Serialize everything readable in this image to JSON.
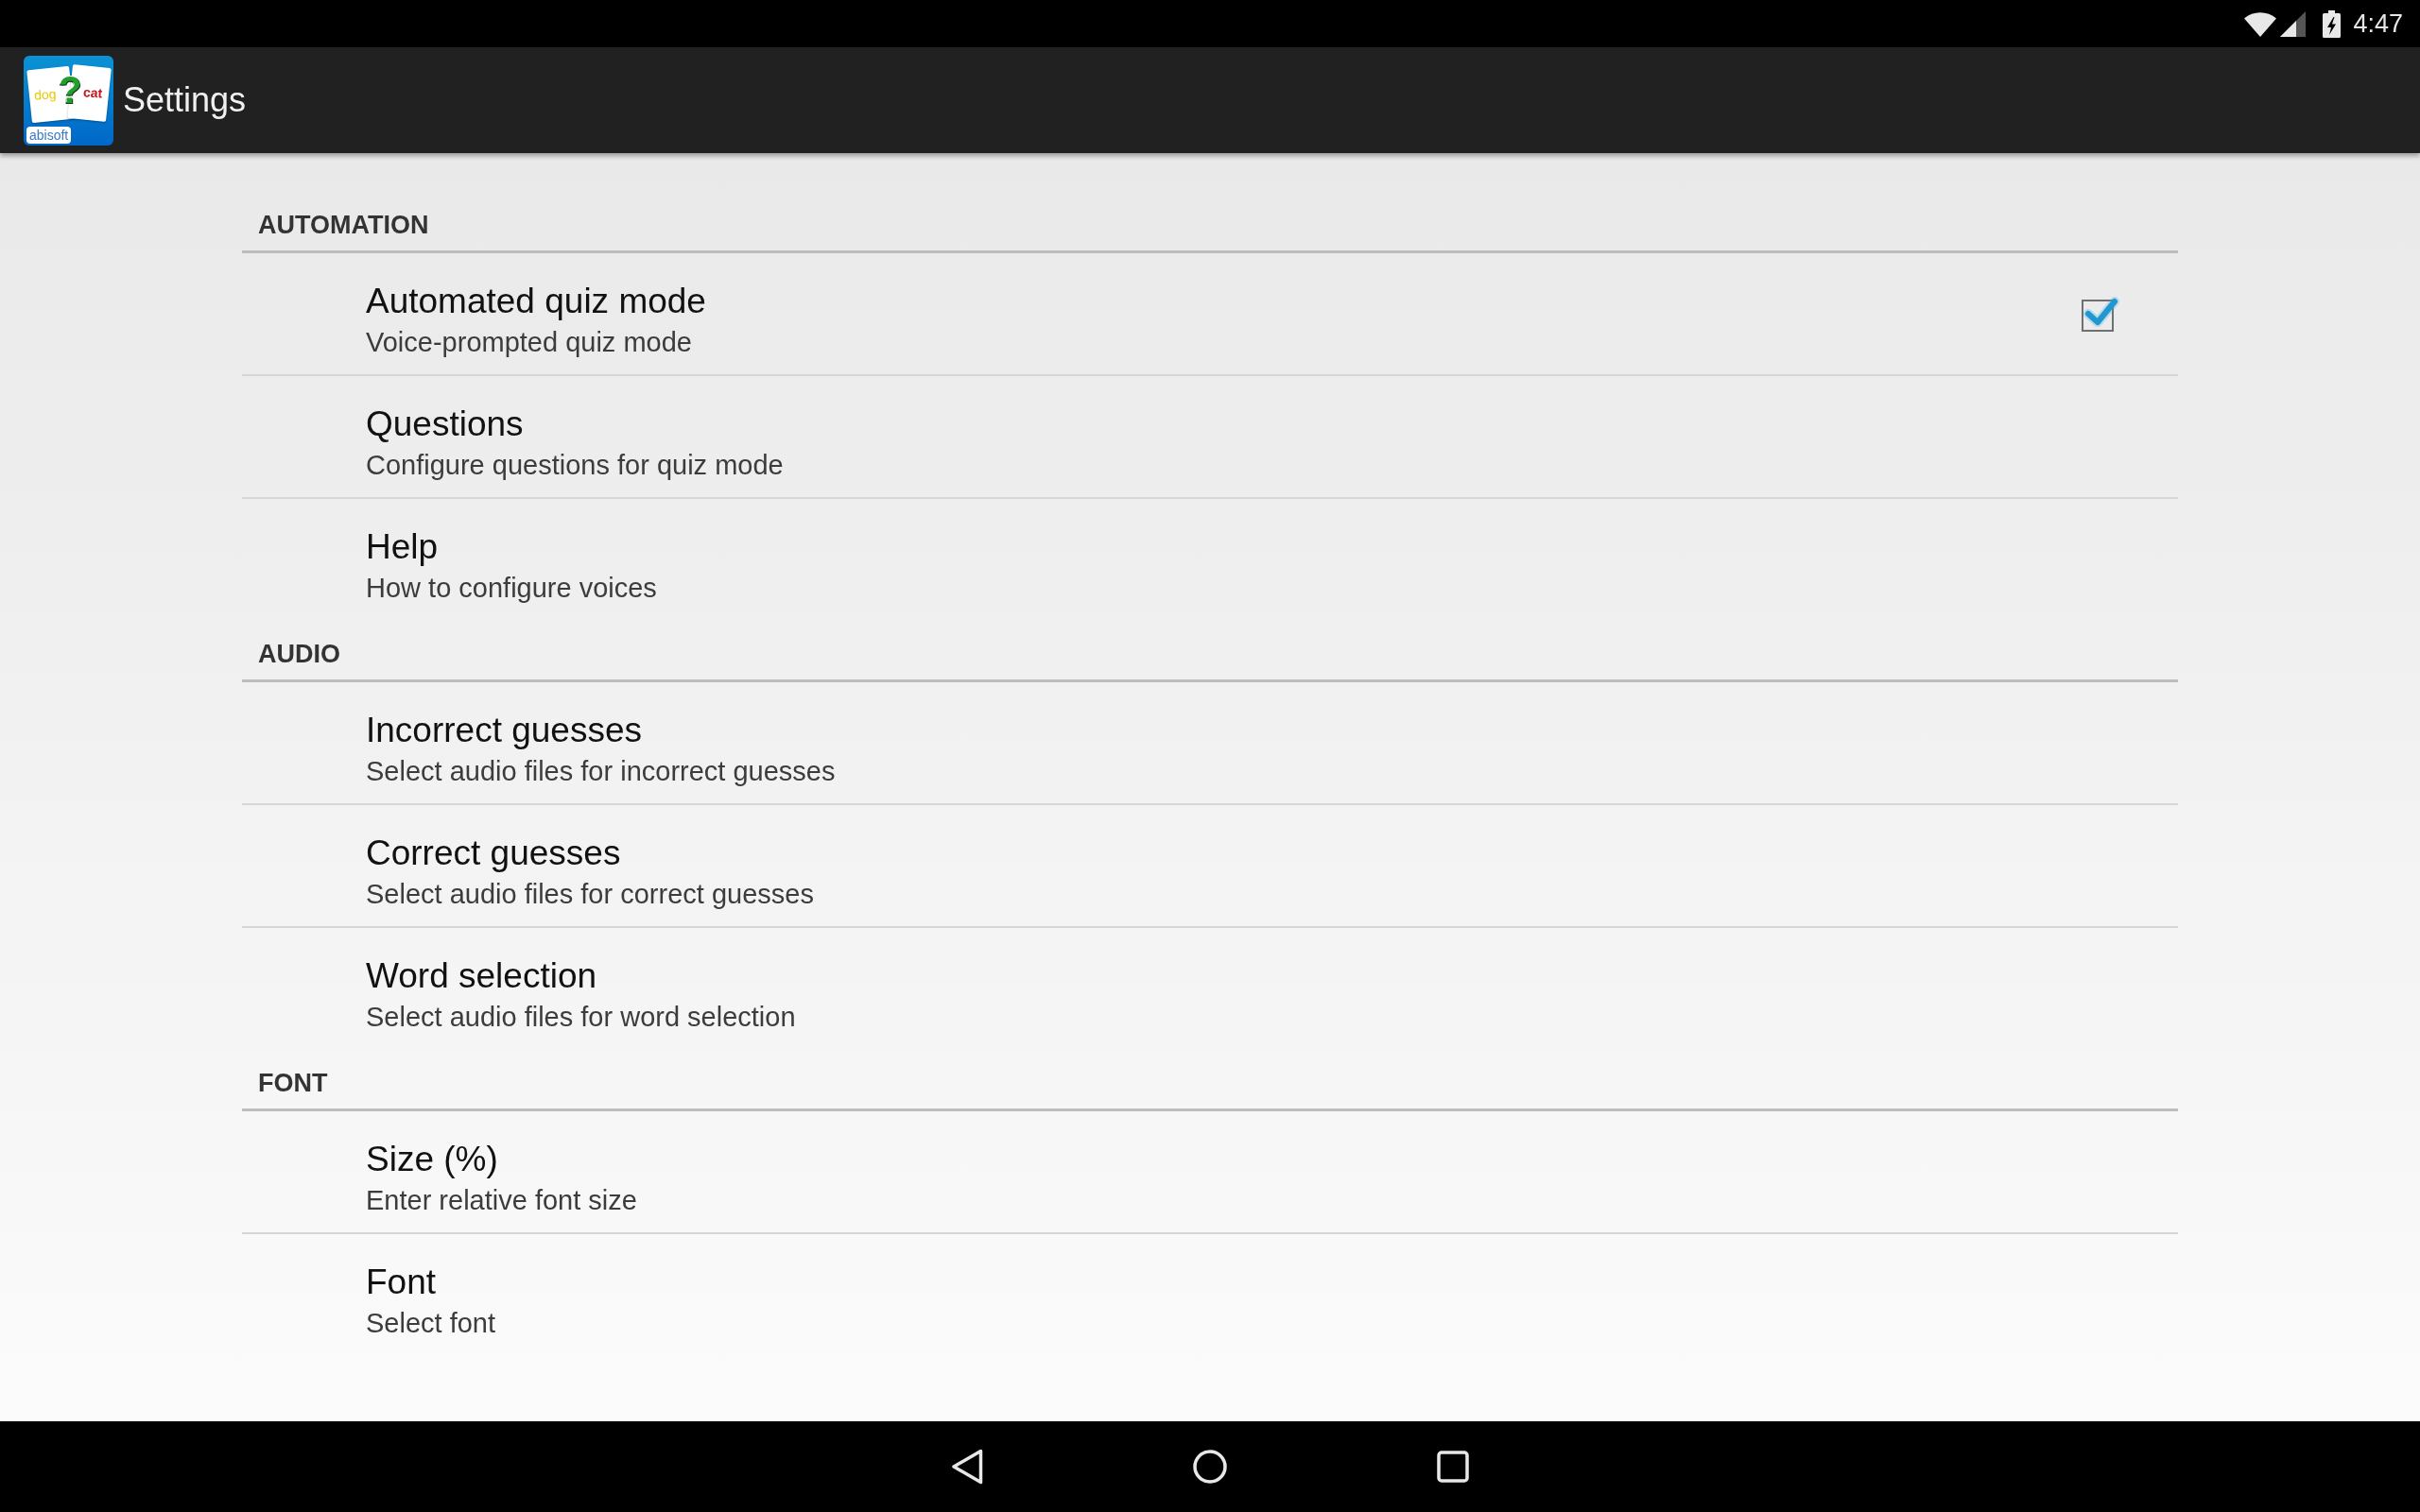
{
  "status_bar": {
    "time": "4:47"
  },
  "app_bar": {
    "app_icon": {
      "left_card_text": "dog",
      "symbol": "?",
      "right_card_text": "cat",
      "label": "abisoft"
    },
    "title": "Settings"
  },
  "sections": [
    {
      "title": "AUTOMATION",
      "items": [
        {
          "kind": "checkbox",
          "title": "Automated quiz mode",
          "summary": "Voice-prompted quiz mode",
          "checked": true
        },
        {
          "kind": "plain",
          "title": "Questions",
          "summary": "Configure questions for quiz mode"
        },
        {
          "kind": "plain",
          "title": "Help",
          "summary": "How to configure voices"
        }
      ]
    },
    {
      "title": "AUDIO",
      "items": [
        {
          "kind": "plain",
          "title": "Incorrect guesses",
          "summary": "Select audio files for incorrect guesses"
        },
        {
          "kind": "plain",
          "title": "Correct guesses",
          "summary": "Select audio files for correct guesses"
        },
        {
          "kind": "plain",
          "title": "Word selection",
          "summary": "Select audio files for word selection"
        }
      ]
    },
    {
      "title": "FONT",
      "items": [
        {
          "kind": "plain",
          "title": "Size (%)",
          "summary": "Enter relative font size"
        },
        {
          "kind": "plain",
          "title": "Font",
          "summary": "Select font"
        }
      ]
    }
  ]
}
